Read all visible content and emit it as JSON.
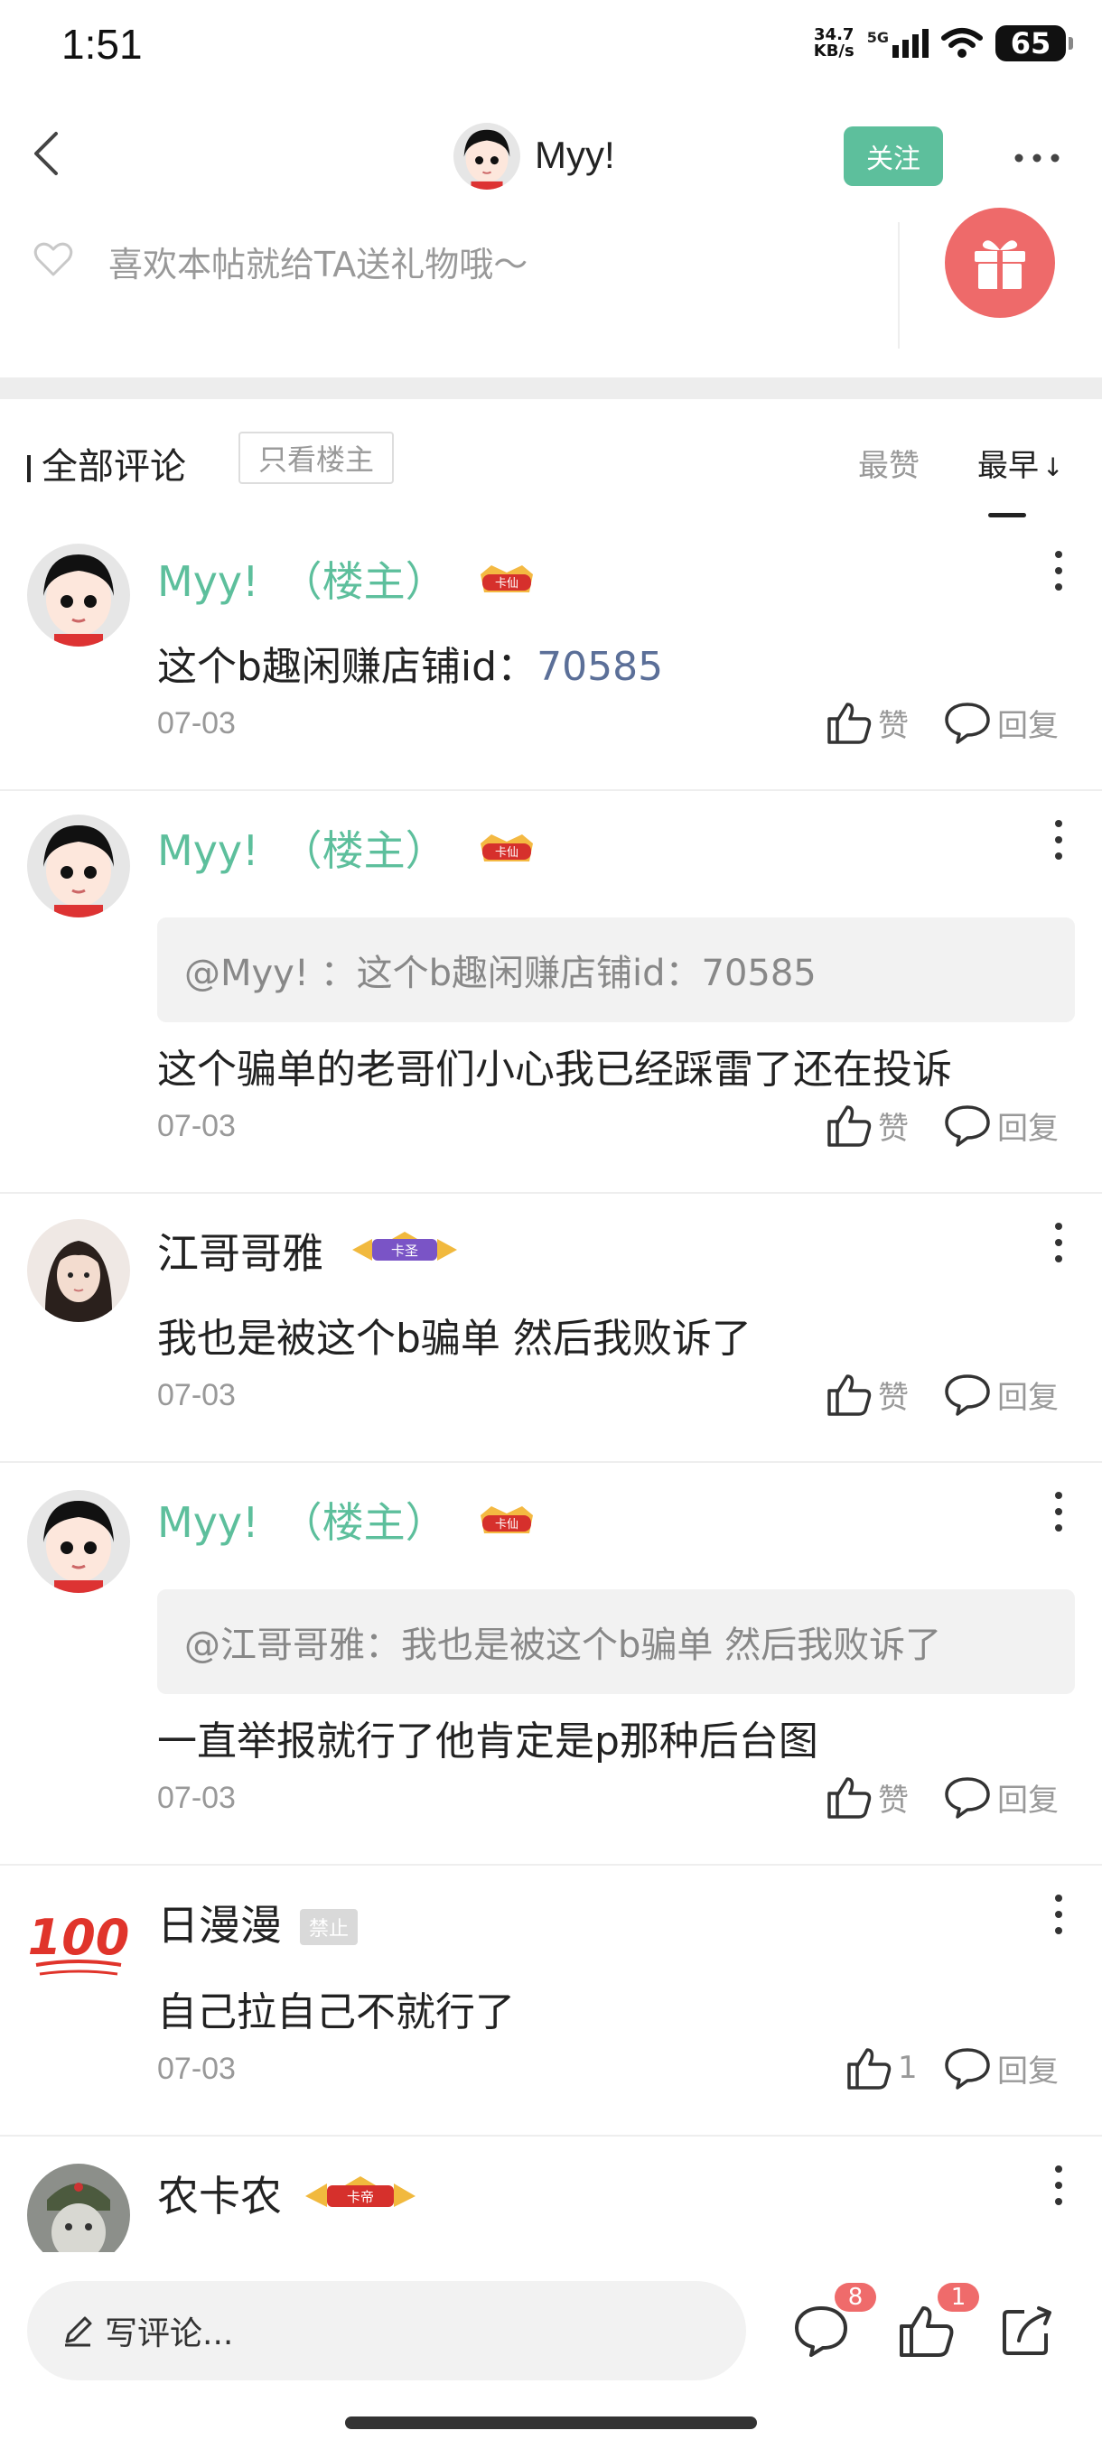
{
  "status_bar": {
    "time": "1:51",
    "net_speed_value": "34.7",
    "net_speed_unit": "KB/s",
    "network": "5G",
    "battery": "65"
  },
  "header": {
    "title": "Myy!",
    "follow_label": "关注"
  },
  "gift_row": {
    "prompt": "喜欢本帖就给TA送礼物哦～"
  },
  "filter": {
    "all_comments": "全部评论",
    "only_owner": "只看楼主",
    "sort_top": "最赞",
    "sort_earliest": "最早",
    "sort_arrow": "↓"
  },
  "comments": [
    {
      "name": "Myy!",
      "owner_tag": "（楼主）",
      "badge": "卡仙",
      "text_prefix": "这个b趣闲赚店铺id：",
      "text_link": "70585",
      "date": "07-03",
      "like_label": "赞",
      "reply_label": "回复"
    },
    {
      "name": "Myy!",
      "owner_tag": "（楼主）",
      "badge": "卡仙",
      "quote": "@Myy! ：这个b趣闲赚店铺id：70585",
      "text": "这个骗单的老哥们小心我已经踩雷了还在投诉",
      "date": "07-03",
      "like_label": "赞",
      "reply_label": "回复"
    },
    {
      "name": "江哥哥雅",
      "badge": "卡圣",
      "text": "我也是被这个b骗单 然后我败诉了",
      "date": "07-03",
      "like_label": "赞",
      "reply_label": "回复"
    },
    {
      "name": "Myy!",
      "owner_tag": "（楼主）",
      "badge": "卡仙",
      "quote": "@江哥哥雅：我也是被这个b骗单 然后我败诉了",
      "text": "一直举报就行了他肯定是p那种后台图",
      "date": "07-03",
      "like_label": "赞",
      "reply_label": "回复"
    },
    {
      "name": "日漫漫",
      "badge": "禁止",
      "text": "自己拉自己不就行了",
      "date": "07-03",
      "like_count": "1",
      "reply_label": "回复"
    },
    {
      "name": "农卡农",
      "badge": "卡帝"
    }
  ],
  "bottom_bar": {
    "write_placeholder": "写评论...",
    "comment_count": "8",
    "like_count": "1"
  },
  "colors": {
    "accent_green": "#5dbf9c",
    "gift_red": "#ee6a6a",
    "badge_red": "#ef6b6b",
    "link_blue": "#5b6f98"
  },
  "icons": [
    "back-icon",
    "more-icon",
    "heart-icon",
    "gift-icon",
    "thumb-up-icon",
    "reply-bubble-icon",
    "pencil-icon",
    "comment-icon",
    "share-icon"
  ]
}
